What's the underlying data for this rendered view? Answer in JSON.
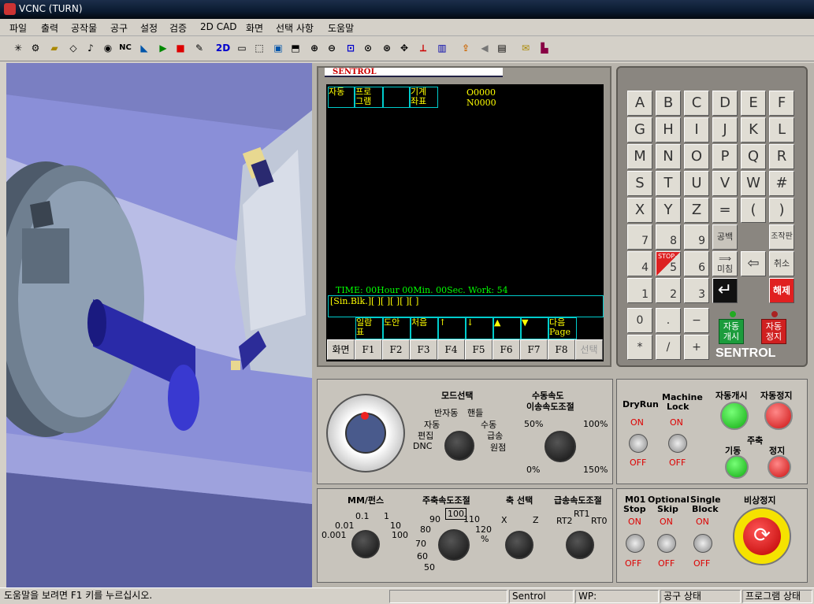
{
  "window": {
    "title": "VCNC (TURN)"
  },
  "menu": [
    "파일",
    "출력",
    "공작물",
    "공구",
    "설정",
    "검증",
    "2D CAD",
    "화면",
    "선택 사항",
    "도움말"
  ],
  "toolbar": {
    "nc_label": "NC",
    "twod_label": "2D"
  },
  "crt": {
    "brand": "SENTROL",
    "tabs": [
      {
        "l1": "자동",
        "l2": ""
      },
      {
        "l1": "프로",
        "l2": "그램"
      },
      {
        "l1": "",
        "l2": ""
      },
      {
        "l1": "기계",
        "l2": "좌표"
      }
    ],
    "program": "O0000",
    "sequence": "N0000",
    "time_line": "TIME: 00Hour 00Min. 00Sec.  Work: 54",
    "block_line": "[Sin.Blk.][   ][   ][   ][   ][   ]",
    "softkeys": [
      {
        "l1": "일람",
        "l2": "표"
      },
      {
        "l1": "도안",
        "l2": ""
      },
      {
        "l1": "처음",
        "l2": ""
      },
      {
        "l1": "↑",
        "l2": ""
      },
      {
        "l1": "↓",
        "l2": ""
      },
      {
        "l1": "▲",
        "l2": ""
      },
      {
        "l1": "▼",
        "l2": ""
      },
      {
        "l1": "다음",
        "l2": "Page"
      }
    ],
    "fkeys": [
      "화면",
      "F1",
      "F2",
      "F3",
      "F4",
      "F5",
      "F6",
      "F7",
      "F8",
      "선택"
    ]
  },
  "keypad": {
    "letters": [
      "A",
      "B",
      "C",
      "D",
      "E",
      "F",
      "G",
      "H",
      "I",
      "J",
      "K",
      "L",
      "M",
      "N",
      "O",
      "P",
      "Q",
      "R",
      "S",
      "T",
      "U",
      "V",
      "W",
      "#",
      "X",
      "Y",
      "Z",
      "=",
      "(",
      ")"
    ],
    "n7": "7",
    "n8": "8",
    "n9": "9",
    "n4": "4",
    "n5": "5",
    "n6": "6",
    "n1": "1",
    "n2": "2",
    "n3": "3",
    "n0": "0",
    "dot": ".",
    "minus": "−",
    "star": "*",
    "slash": "/",
    "plus": "+",
    "space": "공백",
    "operation": "조작판",
    "end_top": "⟹",
    "end": "미침",
    "back": "⇦",
    "cancel": "취소",
    "enter": "↵",
    "release": "해제",
    "stop_badge": "STOP",
    "auto_start_1": "자동",
    "auto_start_2": "개시",
    "auto_stop_1": "자동",
    "auto_stop_2": "정지",
    "brand": "SENTROL"
  },
  "op": {
    "mode_title": "모드선택",
    "mode_labels": [
      "반자동",
      "핸들",
      "자동",
      "수동",
      "편집",
      "급송",
      "DNC",
      "원점"
    ],
    "feed_title_1": "수동속도",
    "feed_title_2": "이송속도조절",
    "feed_labels": [
      "50%",
      "100%",
      "0%",
      "150%"
    ],
    "dryrun": "DryRun",
    "machine_1": "Machine",
    "machine_2": "Lock",
    "on": "ON",
    "off": "OFF",
    "auto_start": "자동개시",
    "auto_stop": "자동정지",
    "spindle": "주축",
    "spindle_start": "기동",
    "spindle_stop": "정지",
    "mm_title": "MM/펀스",
    "mm_labels": [
      "0.1",
      "1",
      "0.01",
      "10",
      "0.001",
      "100"
    ],
    "spindle_speed_title": "주축속도조절",
    "spindle_speed_labels": [
      "100",
      "90",
      "110",
      "80",
      "120",
      "70",
      "%",
      "60",
      "50"
    ],
    "axis_title": "축 선택",
    "axis_x": "X",
    "axis_z": "Z",
    "rapid_title": "급송속도조절",
    "rapid_labels": [
      "RT1",
      "RT2",
      "RT0"
    ],
    "m01_1": "M01",
    "m01_2": "Stop",
    "opt_1": "Optional",
    "opt_2": "Skip",
    "sb_1": "Single",
    "sb_2": "Block",
    "estop": "비상정지"
  },
  "status": {
    "help": "도움말을 보려면 F1 키를 누르십시오.",
    "controller": "Sentrol",
    "wp": "WP:",
    "tool": "공구 상태",
    "program": "프로그램 상태"
  }
}
